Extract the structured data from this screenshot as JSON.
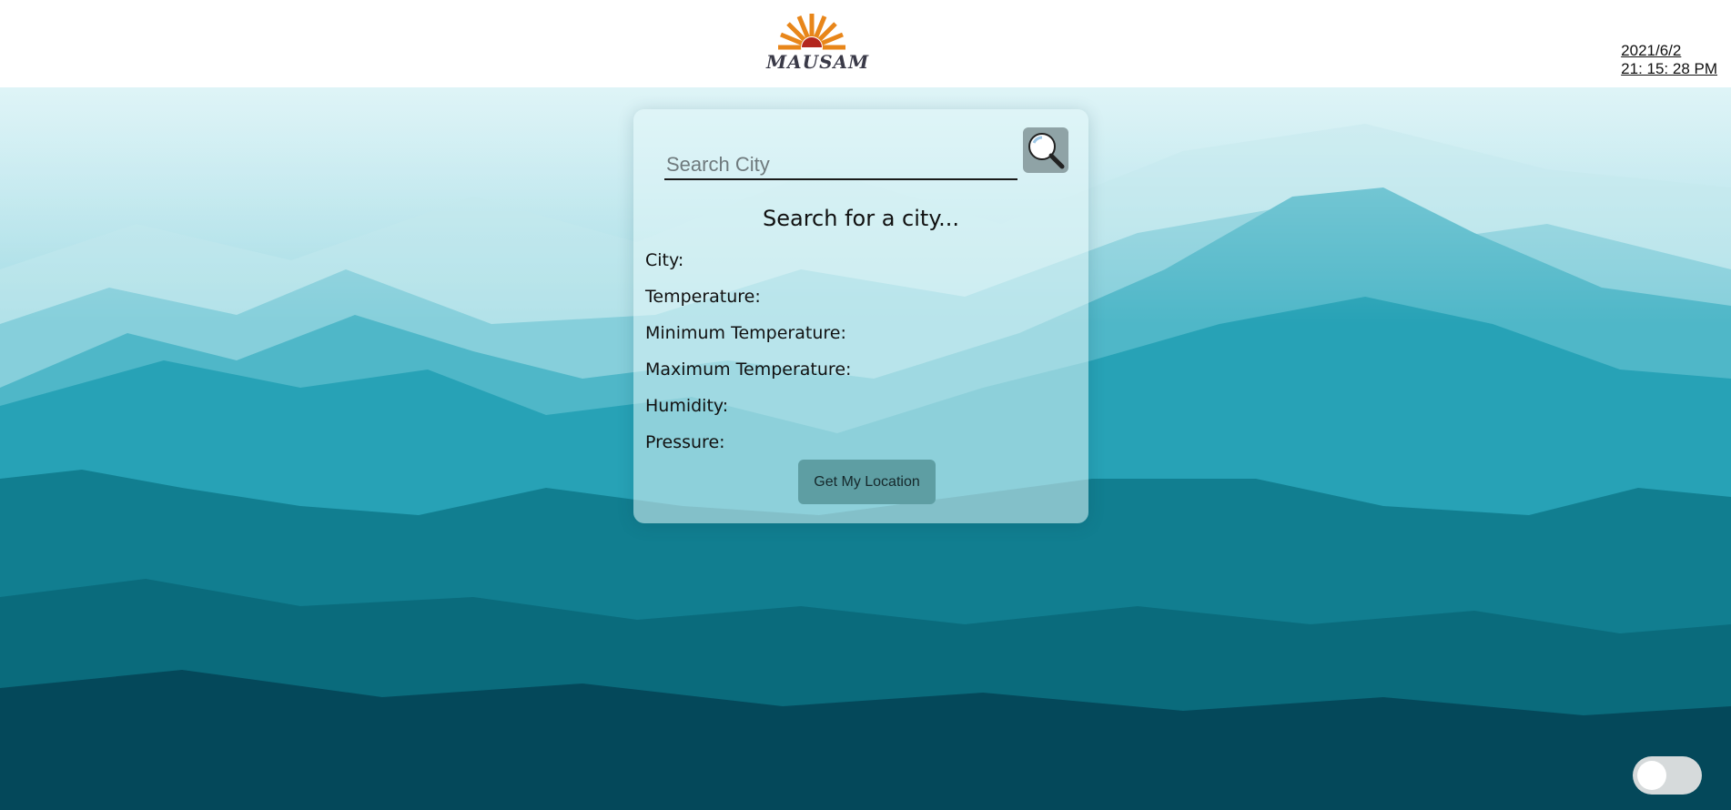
{
  "header": {
    "logo_text": "MAUSAM",
    "date": "2021/6/2",
    "time": "21: 15: 28 PM"
  },
  "search": {
    "placeholder": "Search City",
    "value": ""
  },
  "weather": {
    "status": "Search for a city...",
    "fields": [
      {
        "label": "City:"
      },
      {
        "label": "Temperature:"
      },
      {
        "label": "Minimum Temperature:"
      },
      {
        "label": "Maximum Temperature:"
      },
      {
        "label": "Humidity:"
      },
      {
        "label": "Pressure:"
      }
    ]
  },
  "actions": {
    "location_label": "Get My Location"
  },
  "theme": {
    "dark_mode": false
  },
  "colors": {
    "sun_orange": "#e8861a",
    "sun_red": "#b3261e",
    "teal_light": "#cdeef3",
    "teal_dark": "#04485a"
  },
  "icons": {
    "search": "magnifier-icon",
    "logo": "sun-logo-icon"
  }
}
